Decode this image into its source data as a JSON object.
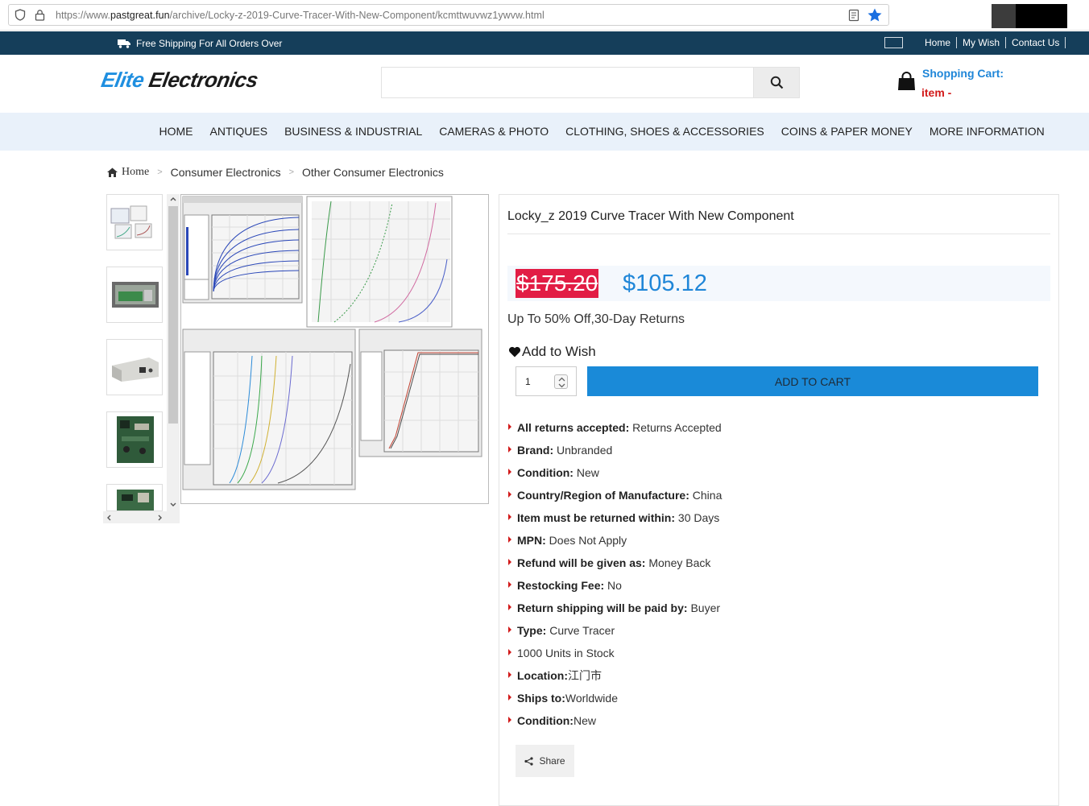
{
  "browser": {
    "url_prefix": "https://www.",
    "url_domain": "pastgreat.fun",
    "url_path": "/archive/Locky-z-2019-Curve-Tracer-With-New-Component/kcmttwuvwz1ywvw.html"
  },
  "topbar": {
    "shipping_text": "Free Shipping For All Orders Over",
    "links": [
      "Home",
      "My Wish",
      "Contact Us"
    ]
  },
  "header": {
    "logo_part1": "Elite",
    "logo_part2": "Electronics",
    "search_placeholder": "",
    "cart_label": "Shopping Cart:",
    "cart_count": "item -"
  },
  "nav": [
    "HOME",
    "ANTIQUES",
    "BUSINESS & INDUSTRIAL",
    "CAMERAS & PHOTO",
    "CLOTHING, SHOES & ACCESSORIES",
    "COINS & PAPER MONEY",
    "MORE INFORMATION"
  ],
  "breadcrumb": [
    "Home",
    "Consumer Electronics",
    "Other Consumer Electronics"
  ],
  "product": {
    "title": "Locky_z 2019 Curve Tracer With New Component",
    "old_price": "$175.20",
    "new_price": "$105.12",
    "promo": "Up To 50% Off,30-Day Returns",
    "wish_label": "Add to Wish",
    "quantity": "1",
    "add_to_cart": "ADD TO CART",
    "share_label": "Share",
    "specs": [
      {
        "label": "All returns accepted:",
        "value": " Returns Accepted"
      },
      {
        "label": "Brand:",
        "value": " Unbranded"
      },
      {
        "label": "Condition:",
        "value": " New"
      },
      {
        "label": "Country/Region of Manufacture:",
        "value": " China"
      },
      {
        "label": "Item must be returned within:",
        "value": " 30 Days"
      },
      {
        "label": "MPN:",
        "value": " Does Not Apply"
      },
      {
        "label": "Refund will be given as:",
        "value": " Money Back"
      },
      {
        "label": "Restocking Fee:",
        "value": " No"
      },
      {
        "label": "Return shipping will be paid by:",
        "value": " Buyer"
      },
      {
        "label": "Type:",
        "value": " Curve Tracer"
      },
      {
        "label": "",
        "value": "1000 Units in Stock"
      },
      {
        "label": "Location:",
        "value": "江门市"
      },
      {
        "label": "Ships to:",
        "value": "Worldwide"
      },
      {
        "label": "Condition:",
        "value": "New"
      }
    ]
  },
  "colors": {
    "topbar": "#153e5a",
    "nav_bg": "#e9f1fa",
    "accent_blue": "#1a8ad8",
    "sale_red": "#e21d45"
  }
}
